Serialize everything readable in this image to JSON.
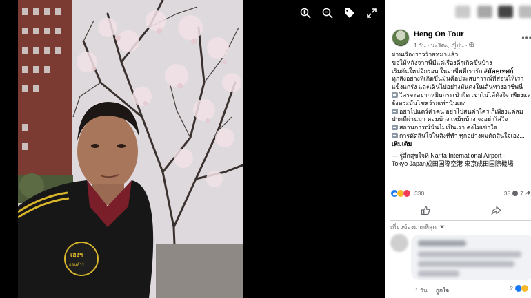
{
  "post": {
    "author": "Heng On Tour",
    "time": "1 วัน",
    "place": "นะริตะ, ญี่ปุ่น",
    "lines": [
      "ผ่านเรื่องราวร้ายหมาแล้ว...",
      "ขอให้หลังจากนี้มีแต่เรื่องดีๆเกิดขึ้นบ้าง",
      "เริ่มกันใหม่อีกรอบ ในอาชีพที่เรารัก",
      "ทุกสิ่งอย่างที่เกิดขึ้นมันคือประสบการณ์ที่สอนให้เรา",
      "แข็งแกร่ง และเดินไปอย่างมั่นคงในเส้นทางอาชีพนี้",
      "ใครจะอยากหยิบกระเป๋าผิด เขาไม่ได้ตั้งใจ เพียงแต่",
      "จังหวะมันโชคร้ายเท่านั้นเอง",
      "อย่าไปแคร์คำคน อย่าไปสนคำใคร ก็เพียงแค่ลม",
      "ปากที่ผ่านมา หอมบ้าง เหม็นบ้าง จงอย่าใส่ใจ",
      "สถานการณ์นั้นไม่เป็นเรา คงไม่เข้าใจ",
      "การตัดสินใจในสิ่งที่ทำ ทุกอย่างผมตัดสินใจเอง..."
    ],
    "hashtag": "#มัคคุเทศก์",
    "see_more": "เพิ่มเติม",
    "location_prefix": "— รู้สึกสุขใจที่",
    "location_l1": "Narita International Airport -",
    "location_l2": "Tokyo Japan成田国際空港 東京成田国際機場"
  },
  "stats": {
    "reactions": "330",
    "comments": "35",
    "shares": "7"
  },
  "comments_sort": "เกี่ยวข้องมากที่สุด",
  "comment": {
    "time": "1 วัน",
    "like": "ถูกใจ",
    "reactions": "2"
  },
  "icons": [
    "zoom-in-icon",
    "zoom-out-icon",
    "tag-icon",
    "fullscreen-icon",
    "like-icon",
    "share-icon"
  ],
  "colors": {
    "like_blue": "#1877f2",
    "haha_yellow": "#f7b928",
    "love_red": "#f33e58",
    "meta_gray": "#65676b"
  }
}
